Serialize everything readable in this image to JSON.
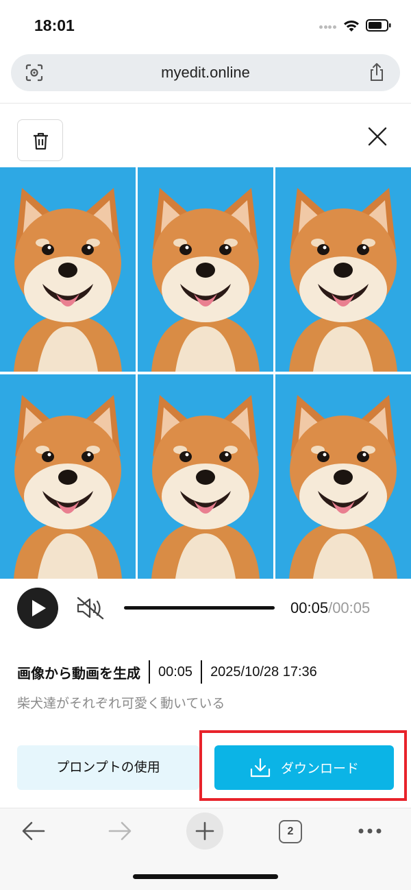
{
  "status_bar": {
    "time": "18:01"
  },
  "browser": {
    "url": "myedit.online",
    "tab_count": "2"
  },
  "player": {
    "current_time": "00:05",
    "separator": "/",
    "total_time": "00:05",
    "progress": 1.0
  },
  "info": {
    "title": "画像から動画を生成",
    "duration": "00:05",
    "datetime": "2025/10/28 17:36",
    "description": "柴犬達がそれぞれ可愛く動いている"
  },
  "actions": {
    "prompt_label": "プロンプトの使用",
    "download_label": "ダウンロード"
  },
  "colors": {
    "accent": "#0bb4e6",
    "prompt_bg": "#e6f6fc",
    "highlight": "#e8232b",
    "image_bg": "#2ea8e4"
  },
  "icons": [
    "lens-icon",
    "share-icon",
    "trash-icon",
    "close-icon",
    "play-icon",
    "mute-icon",
    "download-icon",
    "back-arrow-icon",
    "forward-arrow-icon",
    "plus-icon",
    "more-icon"
  ]
}
